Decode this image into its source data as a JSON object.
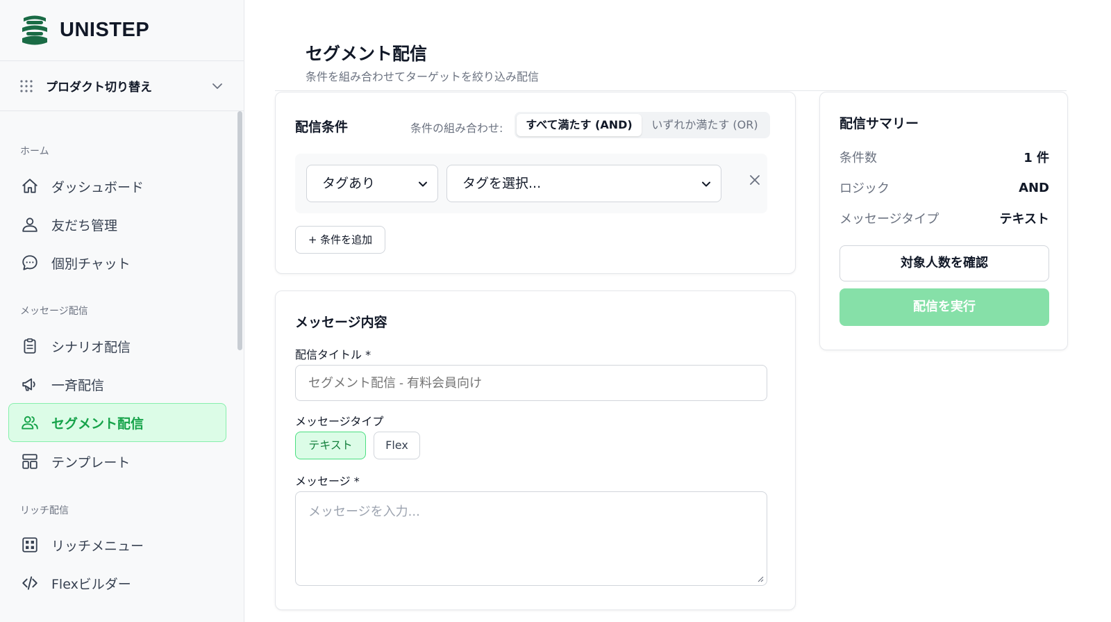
{
  "brand": {
    "name": "UNISTEP"
  },
  "product_switch": {
    "label": "プロダクト切り替え"
  },
  "sidebar": {
    "sections": [
      {
        "label": "ホーム",
        "items": [
          {
            "label": "ダッシュボード",
            "icon": "home-icon"
          },
          {
            "label": "友だち管理",
            "icon": "user-icon"
          },
          {
            "label": "個別チャット",
            "icon": "chat-icon"
          }
        ]
      },
      {
        "label": "メッセージ配信",
        "items": [
          {
            "label": "シナリオ配信",
            "icon": "clipboard-icon"
          },
          {
            "label": "一斉配信",
            "icon": "megaphone-icon"
          },
          {
            "label": "セグメント配信",
            "icon": "users-icon",
            "active": true
          },
          {
            "label": "テンプレート",
            "icon": "template-icon"
          }
        ]
      },
      {
        "label": "リッチ配信",
        "items": [
          {
            "label": "リッチメニュー",
            "icon": "rich-menu-icon"
          },
          {
            "label": "Flexビルダー",
            "icon": "code-icon"
          }
        ]
      }
    ]
  },
  "page": {
    "title": "セグメント配信",
    "subtitle": "条件を組み合わせてターゲットを絞り込み配信"
  },
  "conditions": {
    "title": "配信条件",
    "combo_label": "条件の組み合わせ:",
    "combo_options": [
      "すべて満たす (AND)",
      "いずれか満たす (OR)"
    ],
    "combo_selected": "すべて満たす (AND)",
    "rows": [
      {
        "type": "タグあり",
        "value": "タグを選択..."
      }
    ],
    "add_label": "+ 条件を追加"
  },
  "message": {
    "title": "メッセージ内容",
    "title_label": "配信タイトル *",
    "title_placeholder": "セグメント配信 - 有料会員向け",
    "type_label": "メッセージタイプ",
    "types": [
      "テキスト",
      "Flex"
    ],
    "type_selected": "テキスト",
    "body_label": "メッセージ *",
    "body_placeholder": "メッセージを入力..."
  },
  "summary": {
    "title": "配信サマリー",
    "rows": [
      {
        "key": "条件数",
        "value": "1 件"
      },
      {
        "key": "ロジック",
        "value": "AND"
      },
      {
        "key": "メッセージタイプ",
        "value": "テキスト"
      }
    ],
    "confirm_label": "対象人数を確認",
    "send_label": "配信を実行"
  },
  "colors": {
    "accent": "#16a34a",
    "active_bg": "#dcfce7",
    "send_button": "#86e0a8",
    "brand_logo": "#1a6b45"
  }
}
